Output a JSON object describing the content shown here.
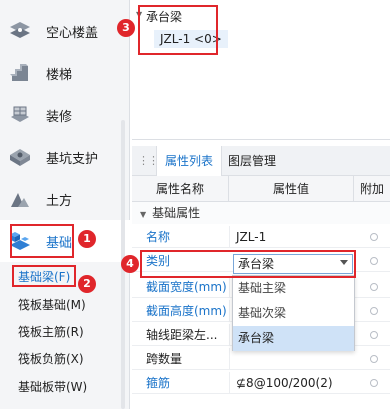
{
  "nav": {
    "items": [
      {
        "label": "空心楼盖",
        "icon": "hollow-slab-icon"
      },
      {
        "label": "楼梯",
        "icon": "stairs-icon"
      },
      {
        "label": "装修",
        "icon": "decoration-icon"
      },
      {
        "label": "基坑支护",
        "icon": "pit-support-icon"
      },
      {
        "label": "土方",
        "icon": "earthwork-icon"
      },
      {
        "label": "基础",
        "icon": "foundation-icon"
      }
    ],
    "sub_items": [
      "基础梁(F)",
      "筏板基础(M)",
      "筏板主筋(R)",
      "筏板负筋(X)",
      "基础板带(W)"
    ]
  },
  "tree": {
    "parent": "承台梁",
    "child": "JZL-1 <0>"
  },
  "tabs": [
    "属性列表",
    "图层管理"
  ],
  "grid": {
    "headers": [
      "属性名称",
      "属性值",
      "附加"
    ],
    "group": "基础属性",
    "rows": [
      {
        "name": "名称",
        "value": "JZL-1"
      },
      {
        "name": "类别",
        "value": "承台梁"
      },
      {
        "name": "截面宽度(mm)",
        "value": ""
      },
      {
        "name": "截面高度(mm)",
        "value": ""
      },
      {
        "name": "轴线距梁左...",
        "value": ""
      },
      {
        "name": "跨数量",
        "value": ""
      },
      {
        "name": "箍筋",
        "value": "⊈8@100/200(2)"
      }
    ]
  },
  "dropdown": {
    "options": [
      "基础主梁",
      "基础次梁",
      "承台梁"
    ],
    "selected": "承台梁"
  },
  "badges": [
    "1",
    "2",
    "3",
    "4"
  ],
  "colors": {
    "accent": "#1a73c9",
    "callout": "#e0262b"
  }
}
